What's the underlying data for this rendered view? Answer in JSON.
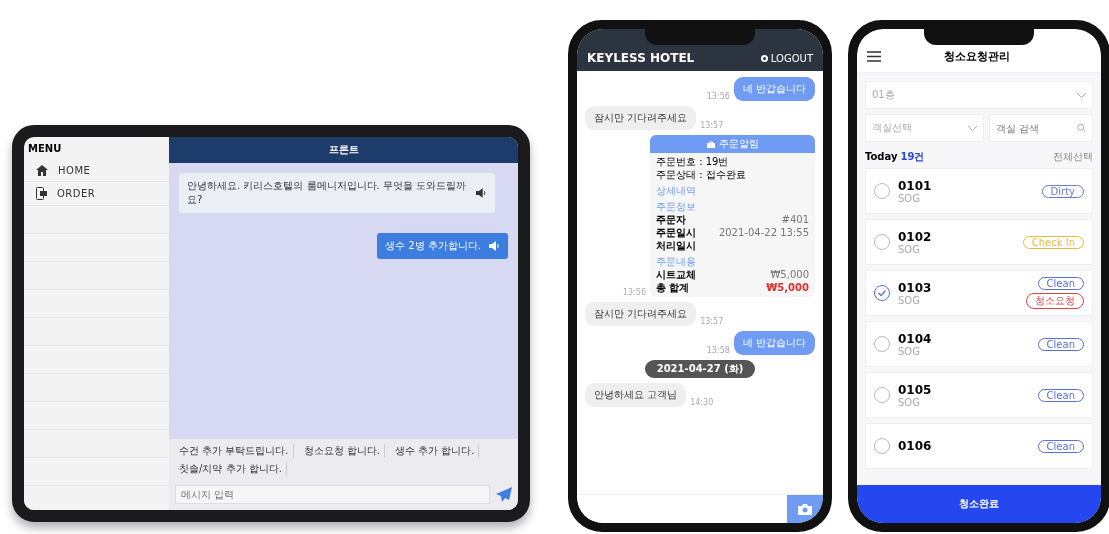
{
  "tablet": {
    "sidebar": {
      "title": "MENU",
      "items": [
        {
          "label": "HOME",
          "kind": "home"
        },
        {
          "label": "ORDER",
          "kind": "order"
        }
      ]
    },
    "header": "프론트",
    "messages": [
      {
        "kind": "received",
        "text": "안녕하세요. 키리스호텔의 룸메니저입니다. 무엇을 도와드릴까요?"
      },
      {
        "kind": "sent",
        "text": "생수 2병 추가합니다."
      }
    ],
    "quick_replies": [
      "수건 추가 부탁드립니다.",
      "청소요청 합니다.",
      "생수 추가 합니다.",
      "칫솔/치약 추가 합니다."
    ],
    "input": {
      "placeholder": "메시지 입력"
    }
  },
  "chat_phone": {
    "title": "KEYLESS HOTEL",
    "logout": "LOGOUT",
    "messages": [
      {
        "kind": "sent",
        "text": "네 반갑습니다",
        "time": "13:56"
      },
      {
        "kind": "received",
        "text": "잠시만 기다려주세요",
        "time": "13:57"
      },
      {
        "kind": "order",
        "title": "주문알림",
        "lines": [
          "주문번호 : 19번",
          "주문상태 : 접수완료"
        ],
        "detail_link": "상세내역",
        "sections": [
          {
            "heading": "주문정보",
            "rows": [
              {
                "label": "주문자",
                "value": "#401"
              },
              {
                "label": "주문일시",
                "value": "2021-04-22 13:55"
              },
              {
                "label": "처리일시"
              }
            ]
          },
          {
            "heading": "주문내용",
            "rows": [
              {
                "label": "시트교체",
                "value": "₩5,000"
              },
              {
                "label": "총 합계",
                "value": "₩5,000",
                "total": true
              }
            ]
          }
        ],
        "time": "13:56"
      },
      {
        "kind": "received",
        "text": "잠시만 기다려주세요",
        "time": "13:57"
      },
      {
        "kind": "sent",
        "text": "네 반갑습니다",
        "time": "13:58"
      },
      {
        "kind": "date",
        "text": "2021-04-27 (화)"
      },
      {
        "kind": "received",
        "text": "안녕하세요 고객님",
        "time": "14:30"
      }
    ]
  },
  "cleaning_phone": {
    "title": "청소요청관리",
    "floor_select": "01층",
    "room_select": "객실선택",
    "search": {
      "placeholder": "객실 검색"
    },
    "today_label": "Today",
    "count": "19건",
    "select_all": "전체선택",
    "rooms": [
      {
        "number": "0101",
        "type": "SOG",
        "checked": false,
        "tags": [
          {
            "kind": "dirty",
            "label": "Dirty"
          }
        ]
      },
      {
        "number": "0102",
        "type": "SOG",
        "checked": false,
        "tags": [
          {
            "kind": "checkin",
            "label": "Check In"
          }
        ]
      },
      {
        "number": "0103",
        "type": "SOG",
        "checked": true,
        "tags": [
          {
            "kind": "clean",
            "label": "Clean"
          },
          {
            "kind": "request",
            "label": "청소요청"
          }
        ]
      },
      {
        "number": "0104",
        "type": "SOG",
        "checked": false,
        "tags": [
          {
            "kind": "clean",
            "label": "Clean"
          }
        ]
      },
      {
        "number": "0105",
        "type": "SOG",
        "checked": false,
        "tags": [
          {
            "kind": "clean",
            "label": "Clean"
          }
        ]
      },
      {
        "number": "0106",
        "checked": false,
        "tags": [
          {
            "kind": "clean",
            "label": "Clean"
          }
        ]
      }
    ],
    "complete_button": "청소완료"
  }
}
